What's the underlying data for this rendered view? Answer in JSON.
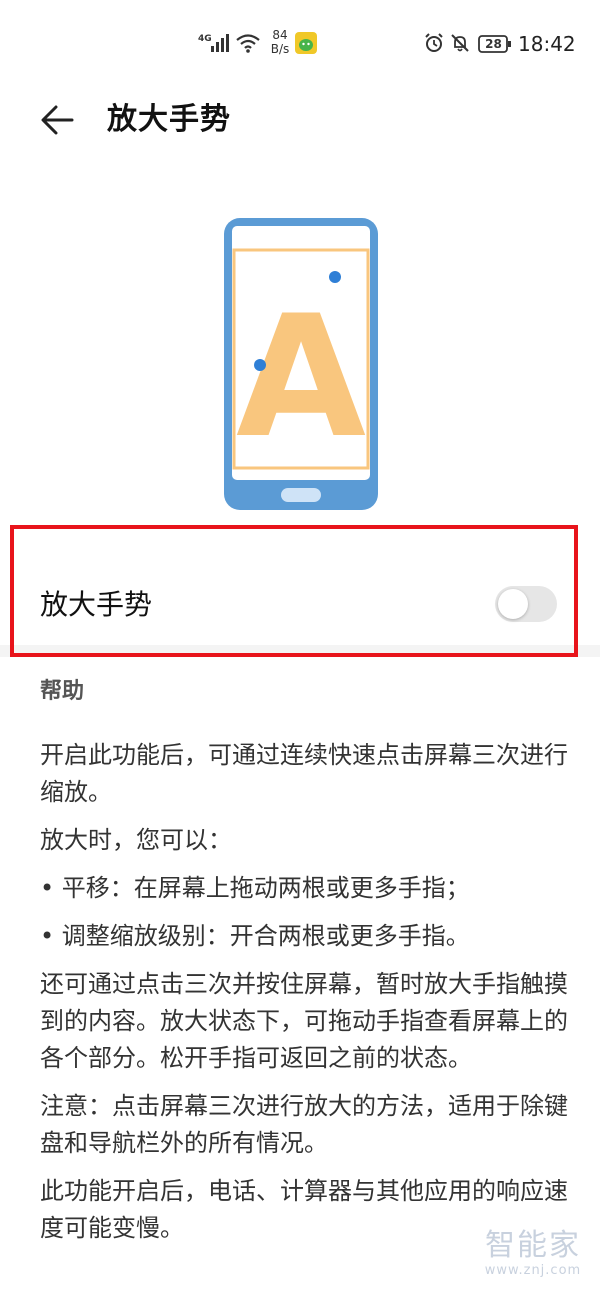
{
  "status_bar": {
    "network_type": "4G",
    "net_speed_value": "84",
    "net_speed_unit": "B/s",
    "battery": "28",
    "time": "18:42"
  },
  "header": {
    "title": "放大手势"
  },
  "setting": {
    "label": "放大手势",
    "enabled": false
  },
  "help": {
    "title": "帮助",
    "paragraphs": [
      "开启此功能后，可通过连续快速点击屏幕三次进行缩放。",
      "放大时，您可以：",
      "• 平移：在屏幕上拖动两根或更多手指；",
      "• 调整缩放级别：开合两根或更多手指。",
      "还可通过点击三次并按住屏幕，暂时放大手指触摸到的内容。放大状态下，可拖动手指查看屏幕上的各个部分。松开手指可返回之前的状态。",
      "注意：点击屏幕三次进行放大的方法，适用于除键盘和导航栏外的所有情况。",
      "此功能开启后，电话、计算器与其他应用的响应速度可能变慢。"
    ]
  },
  "watermark": {
    "title": "智能家",
    "url": "www.znj.com"
  },
  "illustration": {
    "letter": "A"
  },
  "colors": {
    "highlight_border": "#e8141b",
    "phone_frame": "#5b9bd5",
    "letter": "#f9c67e",
    "touch_point": "#2f7fd6",
    "toggle_off": "#e6e6e6"
  }
}
